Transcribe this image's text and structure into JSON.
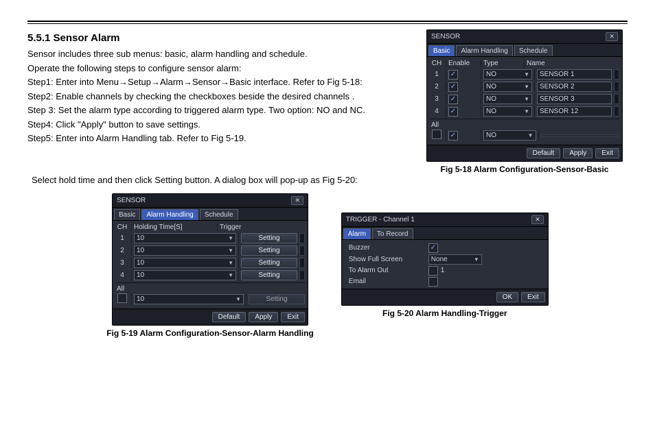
{
  "heading": "5.5.1  Sensor Alarm",
  "body": {
    "p1": "Sensor includes three sub menus: basic, alarm handling and schedule.",
    "p2": "Operate the following steps to configure sensor alarm:",
    "p3": "Step1: Enter into Menu→Setup→Alarm→Sensor→Basic interface. Refer to Fig 5-18:",
    "p4": "Step2: Enable channels by checking the checkboxes beside the desired channels .",
    "p5": "Step 3: Set the alarm type according to triggered alarm type. Two option: NO and NC.",
    "p6": "Step4: Click \"Apply\" button to save settings.",
    "p7": "Step5: Enter into Alarm Handling tab. Refer to Fig 5-19.",
    "p8": "Select hold time and then click Setting button. A dialog box will pop-up as Fig 5-20:"
  },
  "captions": {
    "f18": "Fig 5-18 Alarm Configuration-Sensor-Basic",
    "f19": "Fig 5-19 Alarm Configuration-Sensor-Alarm Handling",
    "f20": "Fig 5-20 Alarm Handling-Trigger"
  },
  "win18": {
    "title": "SENSOR",
    "tabs": [
      "Basic",
      "Alarm Handling",
      "Schedule"
    ],
    "active_tab": 0,
    "headers": {
      "ch": "CH",
      "enable": "Enable",
      "type": "Type",
      "name": "Name",
      "all": "All"
    },
    "rows": [
      {
        "ch": "1",
        "type": "NO",
        "name": "SENSOR 1"
      },
      {
        "ch": "2",
        "type": "NO",
        "name": "SENSOR 2"
      },
      {
        "ch": "3",
        "type": "NO",
        "name": "SENSOR 3"
      },
      {
        "ch": "4",
        "type": "NO",
        "name": "SENSOR 12"
      }
    ],
    "all_type": "NO",
    "buttons": {
      "default": "Default",
      "apply": "Apply",
      "exit": "Exit"
    }
  },
  "win19": {
    "title": "SENSOR",
    "tabs": [
      "Basic",
      "Alarm Handling",
      "Schedule"
    ],
    "active_tab": 1,
    "headers": {
      "ch": "CH",
      "hold": "Holding Time[S]",
      "trig": "Trigger",
      "all": "All"
    },
    "rows": [
      {
        "ch": "1",
        "hold": "10",
        "trig": "Setting"
      },
      {
        "ch": "2",
        "hold": "10",
        "trig": "Setting"
      },
      {
        "ch": "3",
        "hold": "10",
        "trig": "Setting"
      },
      {
        "ch": "4",
        "hold": "10",
        "trig": "Setting"
      }
    ],
    "all_hold": "10",
    "all_trig": "Setting",
    "buttons": {
      "default": "Default",
      "apply": "Apply",
      "exit": "Exit"
    }
  },
  "win20": {
    "title": "TRIGGER - Channel 1",
    "tabs": [
      "Alarm",
      "To Record"
    ],
    "active_tab": 0,
    "props": {
      "buzzer": "Buzzer",
      "fullscreen": "Show Full Screen",
      "fullscreen_val": "None",
      "alarmout": "To Alarm Out",
      "alarmout_val": "1",
      "email": "Email"
    },
    "buttons": {
      "ok": "OK",
      "exit": "Exit"
    }
  }
}
